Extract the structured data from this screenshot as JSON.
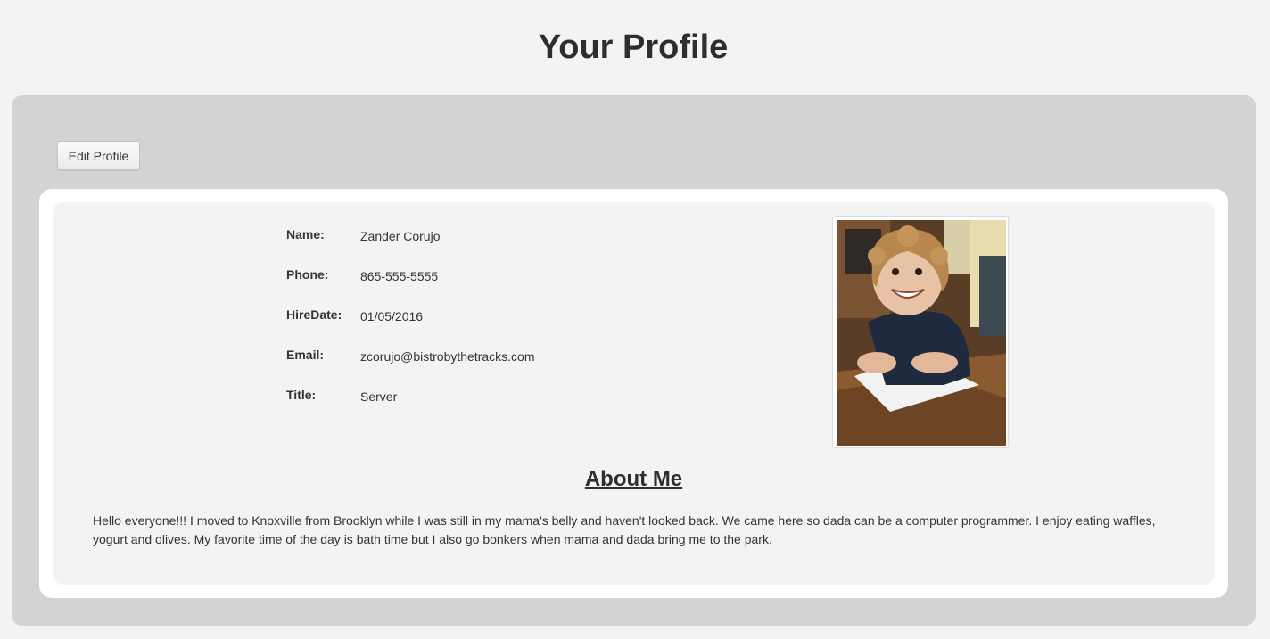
{
  "page": {
    "title": "Your Profile"
  },
  "toolbar": {
    "edit_label": "Edit Profile"
  },
  "profile": {
    "fields": [
      {
        "label": "Name:",
        "value": "Zander Corujo"
      },
      {
        "label": "Phone:",
        "value": "865-555-5555"
      },
      {
        "label": "HireDate:",
        "value": "01/05/2016"
      },
      {
        "label": "Email:",
        "value": "zcorujo@bistrobythetracks.com"
      },
      {
        "label": "Title:",
        "value": "Server"
      }
    ],
    "photo_icon": "profile-photo"
  },
  "about": {
    "heading": "About Me",
    "text": "Hello everyone!!! I moved to Knoxville from Brooklyn while I was still in my mama's belly and haven't looked back. We came here so dada can be a computer programmer. I enjoy eating waffles, yogurt and olives. My favorite time of the day is bath time but I also go bonkers when mama and dada bring me to the park."
  },
  "colors": {
    "page_bg": "#f3f3f3",
    "outer_panel": "#d3d3d3",
    "card": "#ffffff",
    "inner_card": "#f3f3f3",
    "text": "#333333"
  }
}
